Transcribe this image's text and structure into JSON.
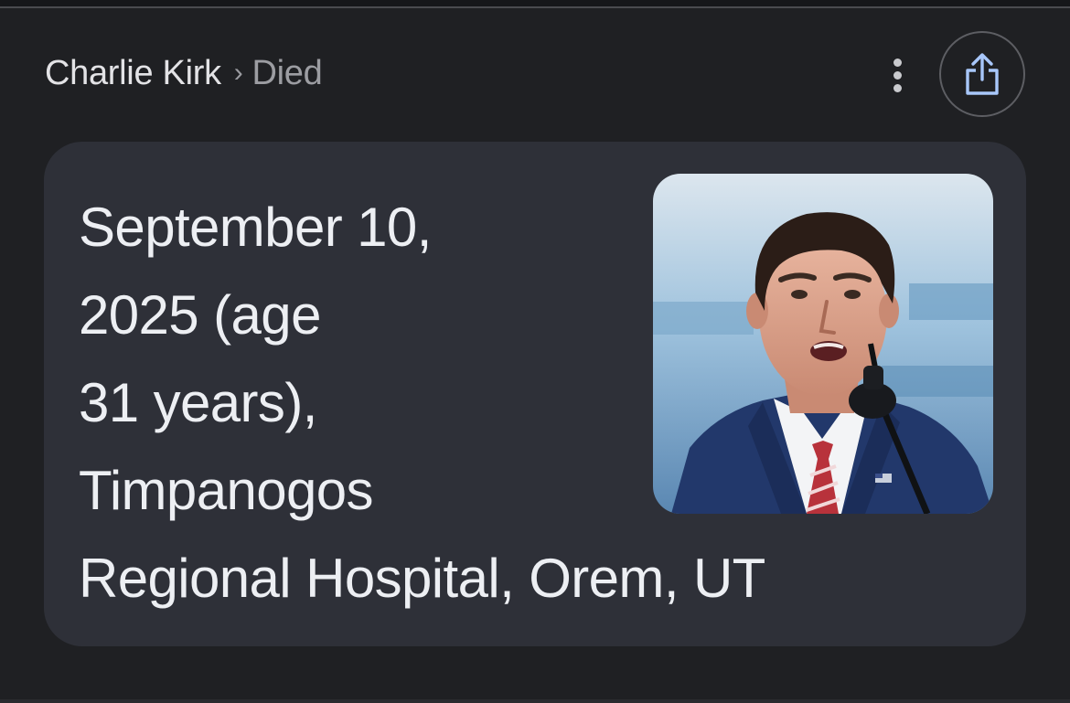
{
  "breadcrumb": {
    "entity": "Charlie Kirk",
    "separator": "›",
    "attribute": "Died"
  },
  "actions": {
    "more_icon": "more-vert-icon",
    "share_icon": "share-icon"
  },
  "answer": {
    "lines": [
      "September 10,",
      "2025 (age",
      "31 years),",
      "Timpanogos",
      "Regional Hospital, Orem, UT"
    ]
  },
  "colors": {
    "background": "#1f2023",
    "card": "#2e3038",
    "answer_text": "#edeff3",
    "share_icon": "#a8c7fa"
  }
}
